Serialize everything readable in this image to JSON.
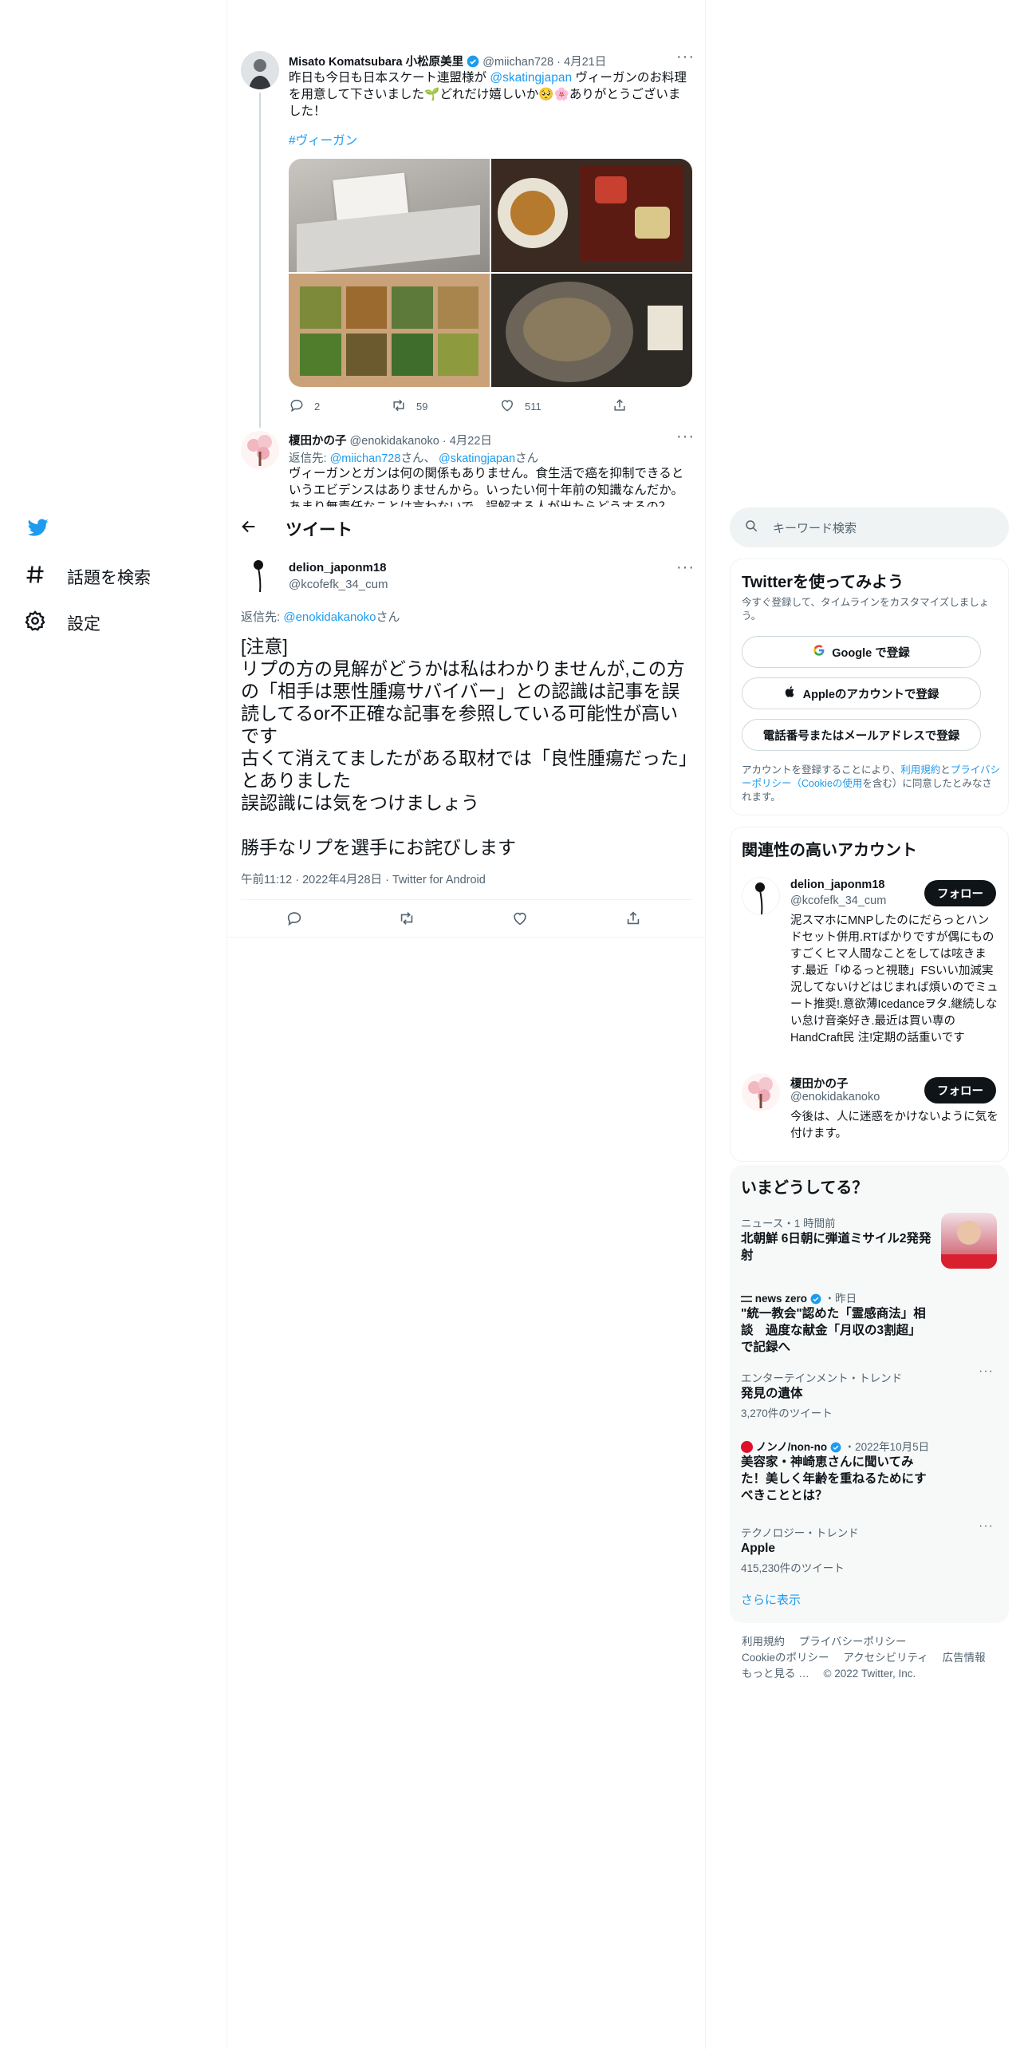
{
  "nav": {
    "items": [
      {
        "label": "話題を検索",
        "icon": "hashtag-icon"
      },
      {
        "label": "設定",
        "icon": "gear-icon"
      }
    ]
  },
  "quoted_tweet": {
    "author": "Misato Komatsubara 小松原美里",
    "handle": "@miichan728",
    "date": "4月21日",
    "text_1": "昨日も今日も日本スケート連盟様が",
    "mention": "@skatingjapan",
    "text_2": "ヴィーガンのお料理を用意して下さいました🌱どれだけ嬉しいか🥺🌸ありがとうございました！",
    "hashtag": "#ヴィーガン",
    "replies": "2",
    "retweets": "59",
    "likes": "511"
  },
  "reply_tweet": {
    "author": "榎田かの子",
    "handle": "@enokidakanoko",
    "date": "4月22日",
    "replying_prefix": "返信先:",
    "replying_to_1": "@miichan728",
    "replying_san_1": "さん、",
    "replying_to_2": "@skatingjapan",
    "replying_san_2": "さん",
    "text": "ヴィーガンとガンは何の関係もありません。食生活で癌を抑制できるというエビデンスはありませんから。いったい何十年前の知識なんだか。あまり無責任なことは言わないで。誤解する人が出たらどうするの？"
  },
  "header": {
    "title": "ツイート"
  },
  "main_tweet": {
    "author": "delion_japonm18",
    "handle": "@kcofefk_34_cum",
    "replying_prefix": "返信先:",
    "replying_to": "@enokidakanoko",
    "replying_san": "さん",
    "lines": [
      "[注意]",
      "リプの方の見解がどうかは私はわかりませんが,この方の「相手は悪性腫瘍サバイバー」との認識は記事を誤読してるor不正確な記事を参照している可能性が高いです",
      "古くて消えてましたがある取材では「良性腫瘍だった」とありました",
      "誤認識には気をつけましょう",
      "",
      "勝手なリプを選手にお詫びします"
    ],
    "time": "午前11:12",
    "date": "2022年4月28日",
    "source": "Twitter for Android"
  },
  "search": {
    "placeholder": "キーワード検索"
  },
  "signup": {
    "title": "Twitterを使ってみよう",
    "subtitle": "今すぐ登録して、タイムラインをカスタマイズしましょう。",
    "google": "Google で登録",
    "apple": "Appleのアカウントで登録",
    "phone": "電話番号またはメールアドレスで登録",
    "legal_1": "アカウントを登録することにより、",
    "legal_terms": "利用規約",
    "legal_and": "と",
    "legal_privacy": "プライバシーポリシー（Cookieの使用",
    "legal_2": "を含む）に同意したとみなされます。"
  },
  "related": {
    "title": "関連性の高いアカウント",
    "follow_label": "フォロー",
    "accounts": [
      {
        "name": "delion_japonm18",
        "handle": "@kcofefk_34_cum",
        "bio": "泥スマホにMNPしたのにだらっとハンドセット併用.RTばかりですが偶にものすごくヒマ人間なことをしては呟きます.最近「ゆるっと視聴」FSいい加減実況してないけどはじまれば煩いのでミュート推奨!.意欲薄Icedanceヲタ.継続しない怠け音楽好き.最近は買い専のHandCraft民 注!定期の話重いです"
      },
      {
        "name": "榎田かの子",
        "handle": "@enokidakanoko",
        "bio": "今後は、人に迷惑をかけないように気を付けます。"
      }
    ]
  },
  "trends": {
    "title": "いまどうしてる？",
    "items": [
      {
        "meta": "ニュース・1 時間前",
        "title": "北朝鮮 6日朝に弾道ミサイル2発発射",
        "has_image": true
      },
      {
        "source": "news zero",
        "meta_time": "・昨日",
        "title": "\"統一教会\"認めた「霊感商法」相談　過度な献金「月収の3割超」で記録へ"
      },
      {
        "meta": "エンターテインメント・トレンド",
        "title": "発見の遺体",
        "count": "3,270件のツイート"
      },
      {
        "source": "ノンノ/non-no",
        "meta_time": "・2022年10月5日",
        "title": "美容家・神崎恵さんに聞いてみた！美しく年齢を重ねるためにすべきこととは？"
      },
      {
        "meta": "テクノロジー・トレンド",
        "title": "Apple",
        "count": "415,230件のツイート"
      }
    ],
    "show_more": "さらに表示"
  },
  "footer": {
    "links": [
      "利用規約",
      "プライバシーポリシー",
      "Cookieのポリシー",
      "アクセシビリティ",
      "広告情報",
      "もっと見る …"
    ],
    "copyright": "© 2022 Twitter, Inc."
  }
}
